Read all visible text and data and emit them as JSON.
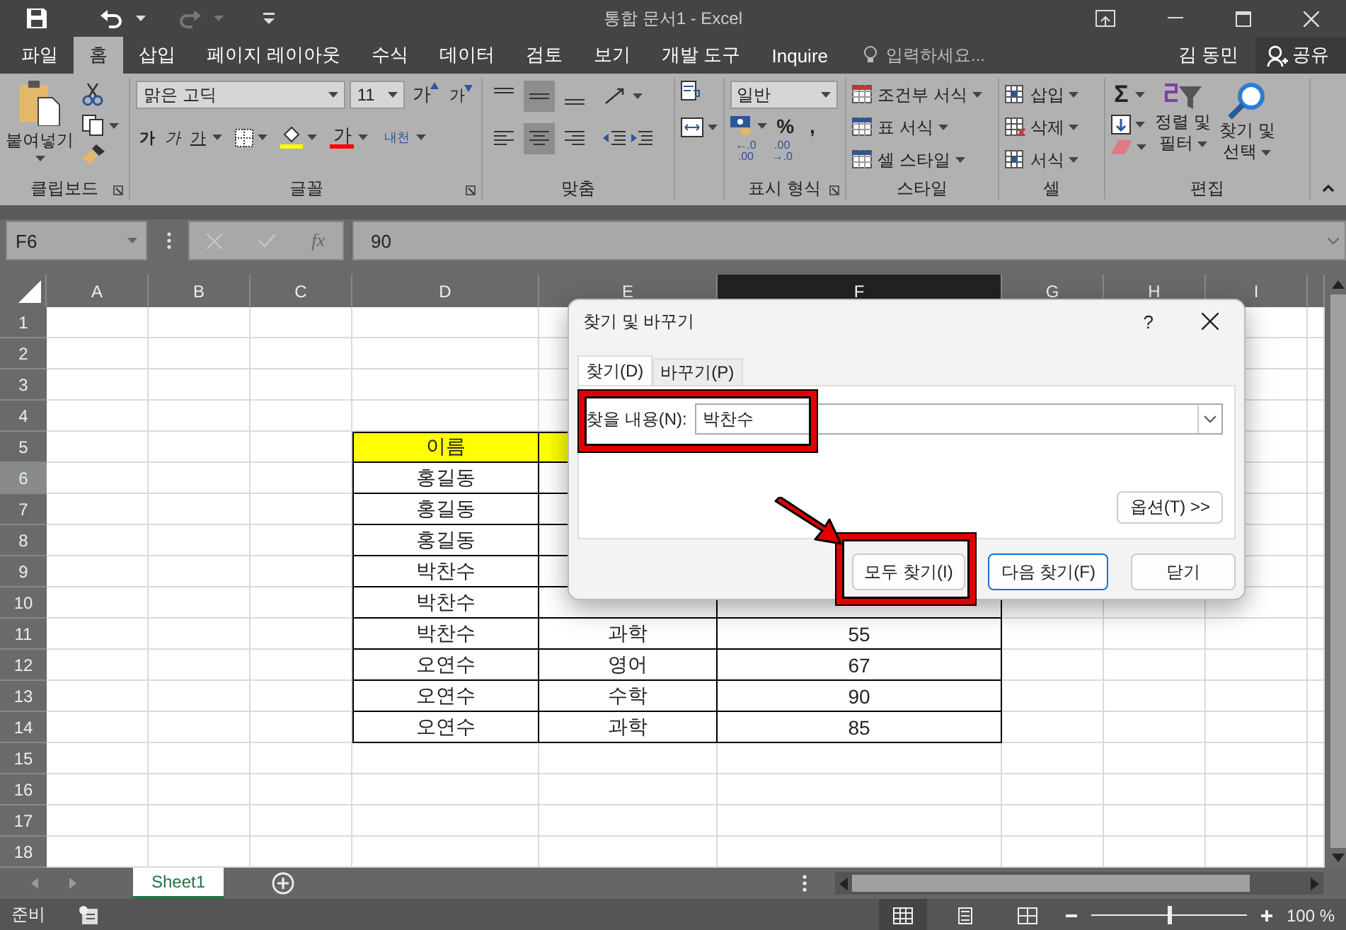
{
  "title_bar": {
    "title": "통합 문서1 - Excel"
  },
  "tabs": [
    {
      "label": "파일",
      "selected": false
    },
    {
      "label": "홈",
      "selected": true
    },
    {
      "label": "삽입",
      "selected": false
    },
    {
      "label": "페이지 레이아웃",
      "selected": false
    },
    {
      "label": "수식",
      "selected": false
    },
    {
      "label": "데이터",
      "selected": false
    },
    {
      "label": "검토",
      "selected": false
    },
    {
      "label": "보기",
      "selected": false
    },
    {
      "label": "개발 도구",
      "selected": false
    },
    {
      "label": "Inquire",
      "selected": false
    }
  ],
  "tell_me": {
    "placeholder": "입력하세요..."
  },
  "user": "김 동민",
  "share_button": "공유",
  "ribbon": {
    "clipboard": {
      "paste": "붙여넣기",
      "label": "클립보드"
    },
    "font": {
      "name": "맑은 고딕",
      "size": "11",
      "grow": "가",
      "shrink": "가",
      "bold": "가",
      "italic": "가",
      "underline": "가",
      "font_color": "가",
      "phonetic": "내천",
      "label": "글꼴"
    },
    "alignment": {
      "vertical": [
        {
          "selected": false
        },
        {
          "selected": true
        },
        {
          "selected": false
        }
      ],
      "horizontal": [
        {
          "selected": false
        },
        {
          "selected": true
        },
        {
          "selected": false
        }
      ],
      "label": "맞춤"
    },
    "number": {
      "format": "일반",
      "percent": "%",
      "comma": ",",
      "increase_decimal": [
        "←.0",
        ".00"
      ],
      "decrease_decimal": [
        ".00",
        "→.0"
      ],
      "label": "표시 형식"
    },
    "styles": {
      "items": [
        "조건부 서식",
        "표 서식",
        "셀 스타일"
      ],
      "label": "스타일"
    },
    "cells": {
      "items": [
        "삽입",
        "삭제",
        "서식"
      ],
      "label": "셀"
    },
    "editing": {
      "sum": "Σ",
      "sort_filter": [
        "정렬 및",
        "필터"
      ],
      "find_select": [
        "찾기 및",
        "선택"
      ],
      "label": "편집"
    }
  },
  "formula_bar": {
    "name_box": "F6",
    "function_label": "fx",
    "value": "90"
  },
  "sheet": {
    "columns": [
      {
        "label": "A",
        "selected": false
      },
      {
        "label": "B",
        "selected": false
      },
      {
        "label": "C",
        "selected": false
      },
      {
        "label": "D",
        "selected": false
      },
      {
        "label": "E",
        "selected": false
      },
      {
        "label": "F",
        "selected": true
      },
      {
        "label": "G",
        "selected": false
      },
      {
        "label": "H",
        "selected": false
      },
      {
        "label": "I",
        "selected": false
      }
    ],
    "rows": [
      {
        "label": "1",
        "selected": false
      },
      {
        "label": "2",
        "selected": false
      },
      {
        "label": "3",
        "selected": false
      },
      {
        "label": "4",
        "selected": false
      },
      {
        "label": "5",
        "selected": false
      },
      {
        "label": "6",
        "selected": true
      },
      {
        "label": "7",
        "selected": false
      },
      {
        "label": "8",
        "selected": false
      },
      {
        "label": "9",
        "selected": false
      },
      {
        "label": "10",
        "selected": false
      },
      {
        "label": "11",
        "selected": false
      },
      {
        "label": "12",
        "selected": false
      },
      {
        "label": "13",
        "selected": false
      },
      {
        "label": "14",
        "selected": false
      },
      {
        "label": "15",
        "selected": false
      },
      {
        "label": "16",
        "selected": false
      },
      {
        "label": "17",
        "selected": false
      },
      {
        "label": "18",
        "selected": false
      }
    ]
  },
  "table": {
    "rows": [
      {
        "kind": "header",
        "cells": [
          "이름"
        ]
      },
      {
        "kind": "data",
        "cells": [
          "홍길동"
        ]
      },
      {
        "kind": "data",
        "cells": [
          "홍길동"
        ]
      },
      {
        "kind": "data",
        "cells": [
          "홍길동"
        ]
      },
      {
        "kind": "data",
        "cells": [
          "박찬수"
        ]
      },
      {
        "kind": "data",
        "cells": [
          "박찬수"
        ]
      },
      {
        "kind": "data",
        "cells": [
          "박찬수",
          "과학",
          "55"
        ]
      },
      {
        "kind": "data",
        "cells": [
          "오연수",
          "영어",
          "67"
        ]
      },
      {
        "kind": "data",
        "cells": [
          "오연수",
          "수학",
          "90"
        ]
      },
      {
        "kind": "data",
        "cells": [
          "오연수",
          "과학",
          "85"
        ]
      }
    ]
  },
  "dialog": {
    "title": "찾기 및 바꾸기",
    "help": "?",
    "tabs": [
      {
        "label": "찾기(D)",
        "selected": true
      },
      {
        "label": "바꾸기(P)",
        "selected": false
      }
    ],
    "find_label": "찾을 내용(N):",
    "find_value": "박찬수",
    "options_button": "옵션(T) >>",
    "buttons": [
      {
        "label": "모두 찾기(I)",
        "default": false
      },
      {
        "label": "다음 찾기(F)",
        "default": true
      },
      {
        "label": "닫기",
        "default": false
      }
    ]
  },
  "sheet_tabs": [
    {
      "label": "Sheet1",
      "selected": true
    }
  ],
  "status_bar": {
    "mode": "준비",
    "views": [
      {
        "selected": true
      },
      {
        "selected": false
      },
      {
        "selected": false
      }
    ],
    "zoom_slider": {
      "level": 0.5
    },
    "zoom": "100 %"
  }
}
